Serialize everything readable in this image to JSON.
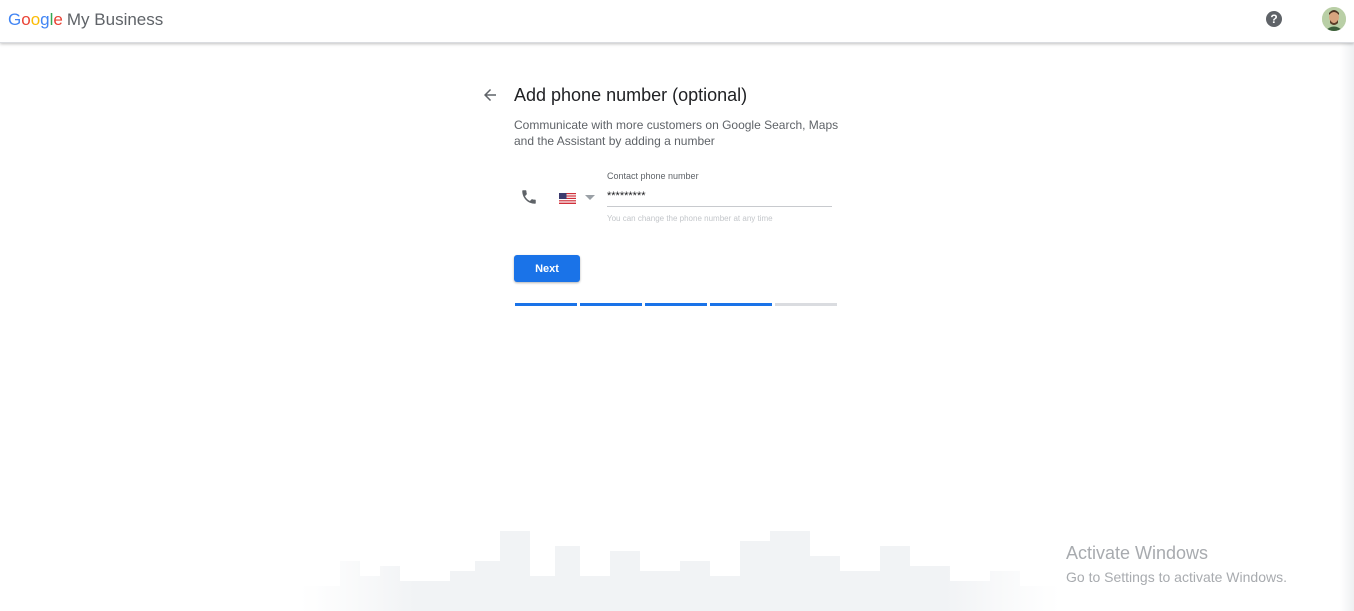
{
  "header": {
    "logo_google": [
      "G",
      "o",
      "o",
      "g",
      "l",
      "e"
    ],
    "logo_colors": [
      "#4285F4",
      "#EA4335",
      "#FBBC05",
      "#4285F4",
      "#34A853",
      "#EA4335"
    ],
    "product_name": "My Business",
    "help_glyph": "?",
    "help_icon": "help-circle-icon",
    "avatar_icon": "user-avatar"
  },
  "main": {
    "title": "Add phone number (optional)",
    "description": "Communicate with more customers on Google Search, Maps and the Assistant by adding a number",
    "phone_field": {
      "label": "Contact phone number",
      "value": "*********",
      "hint": "You can change the phone number at any time",
      "country": "US"
    },
    "next_label": "Next",
    "progress": {
      "total_steps": 5,
      "completed_steps": 4
    }
  },
  "watermark": {
    "line1": "Activate Windows",
    "line2": "Go to Settings to activate Windows."
  },
  "colors": {
    "accent": "#1a73e8",
    "progress_inactive": "#dadce0"
  }
}
